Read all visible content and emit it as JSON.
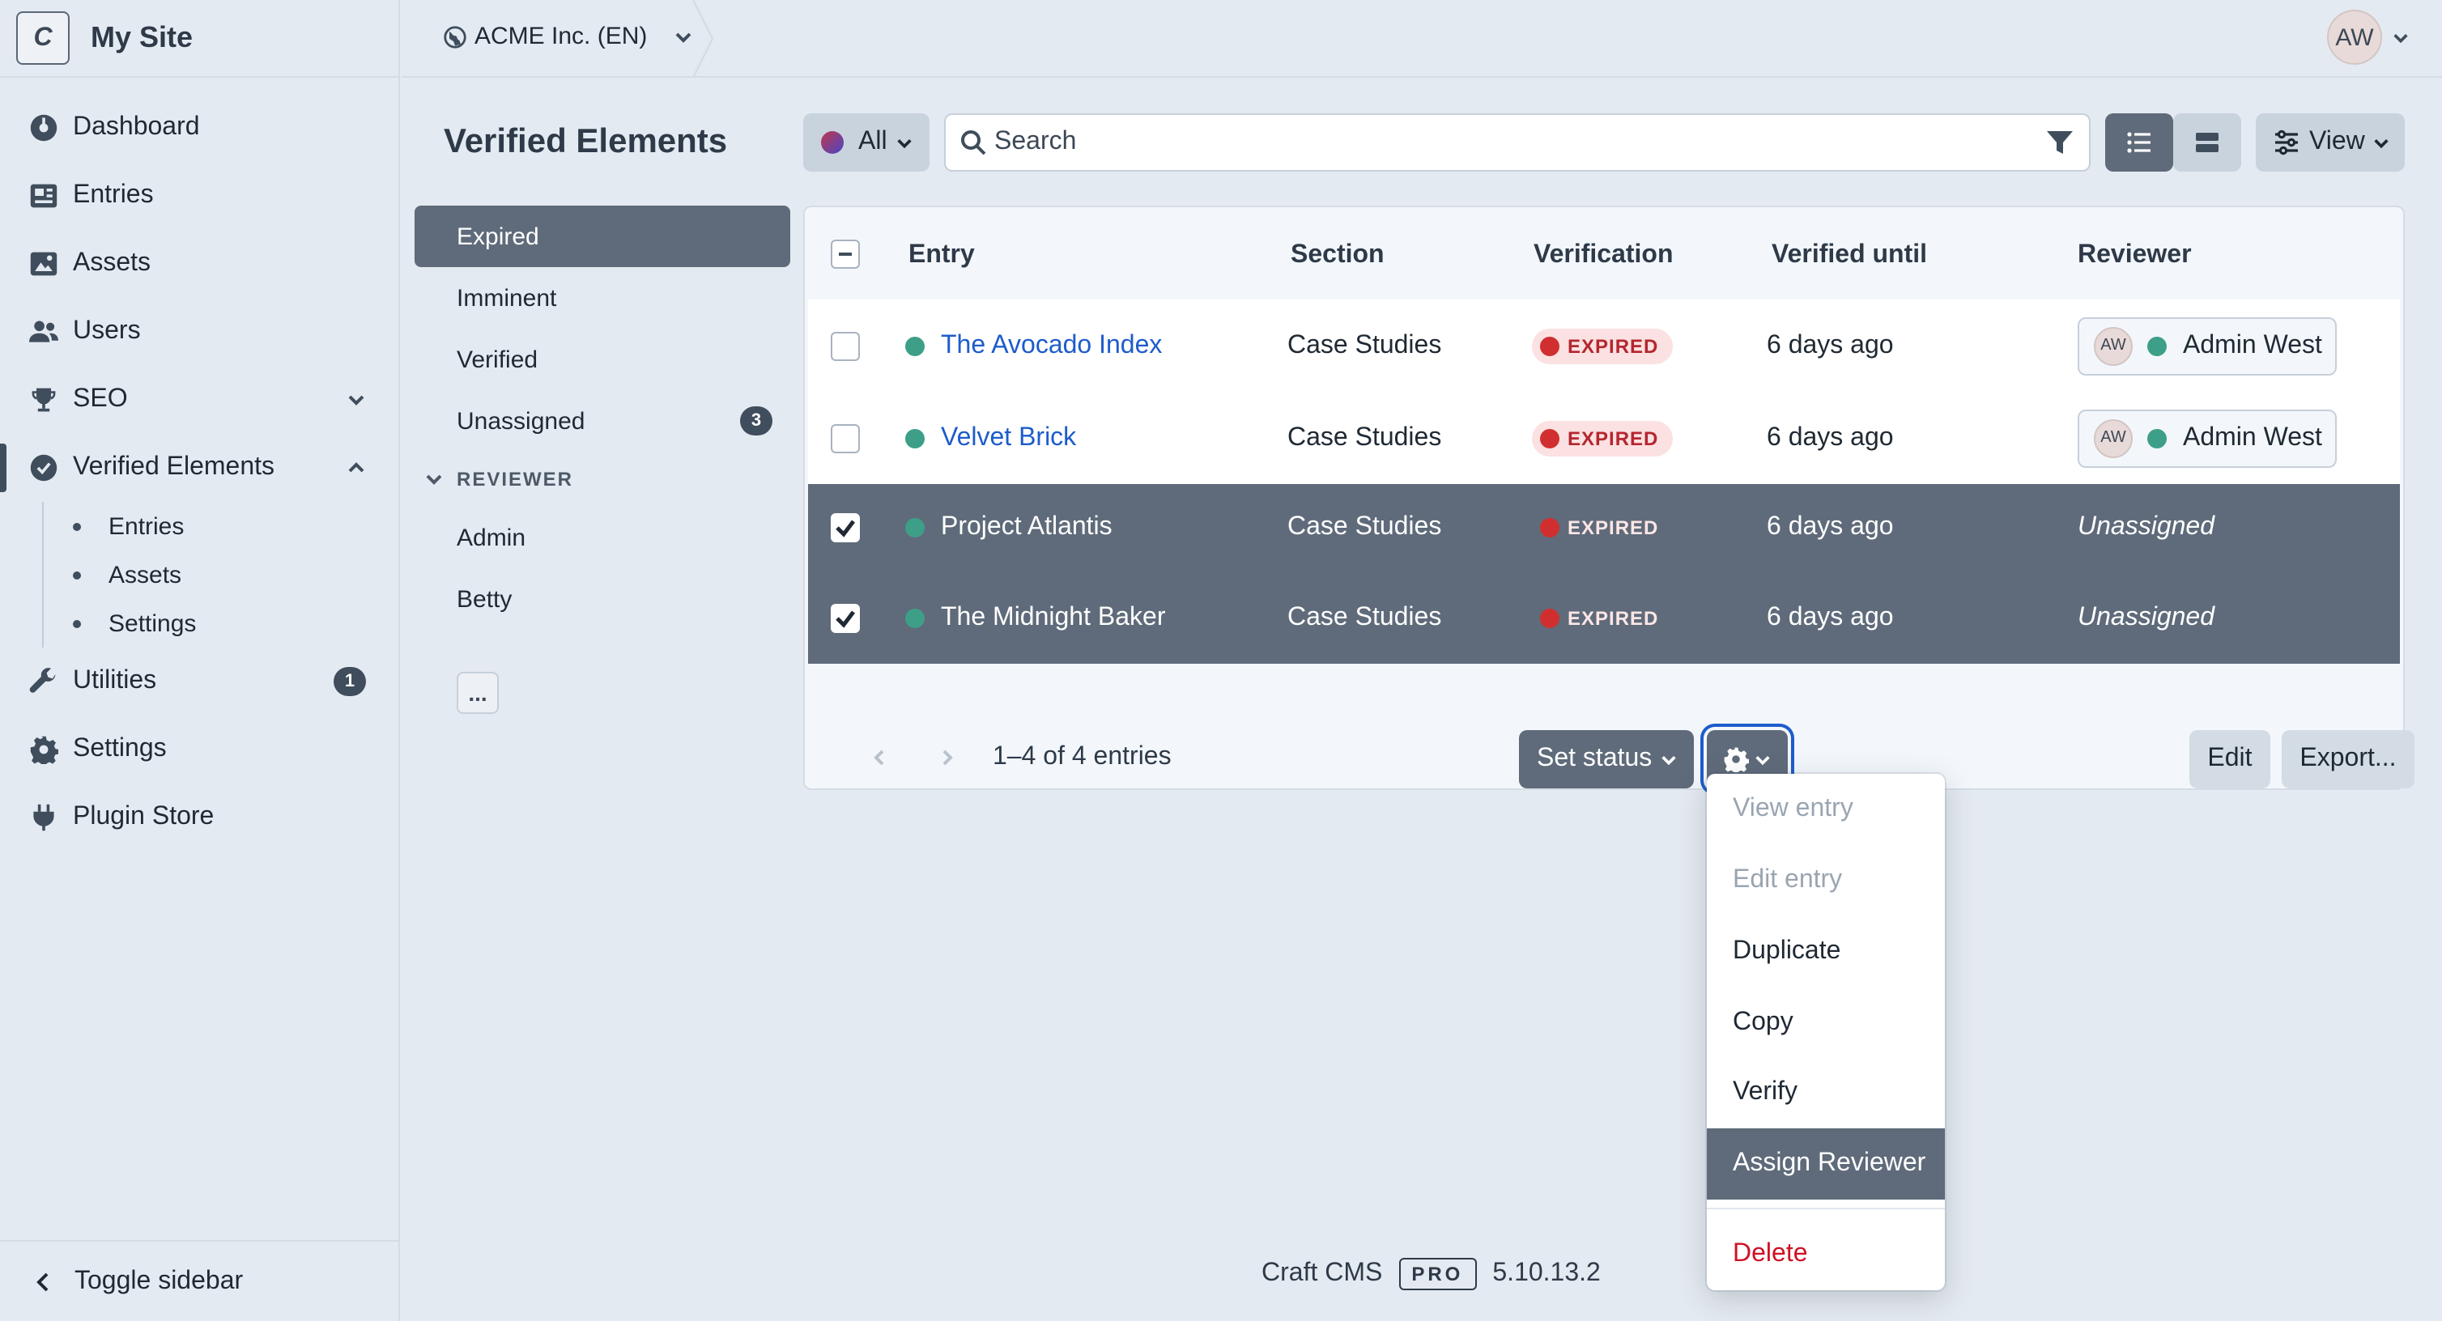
{
  "site": {
    "logo": "C",
    "name": "My Site"
  },
  "sidebar": {
    "items": [
      {
        "label": "Dashboard",
        "icon": "dashboard-icon"
      },
      {
        "label": "Entries",
        "icon": "entries-icon"
      },
      {
        "label": "Assets",
        "icon": "image-icon"
      },
      {
        "label": "Users",
        "icon": "users-icon"
      },
      {
        "label": "SEO",
        "icon": "trophy-icon"
      },
      {
        "label": "Verified Elements",
        "icon": "check-badge-icon"
      },
      {
        "label": "Utilities",
        "icon": "wrench-icon",
        "badge": "1"
      },
      {
        "label": "Settings",
        "icon": "gear-icon"
      },
      {
        "label": "Plugin Store",
        "icon": "plug-icon"
      }
    ],
    "subitems": [
      "Entries",
      "Assets",
      "Settings"
    ],
    "toggle_label": "Toggle sidebar"
  },
  "topbar": {
    "site_switcher": "ACME Inc. (EN)",
    "user_initials": "AW"
  },
  "page": {
    "title": "Verified Elements",
    "status_filter": "All",
    "search_placeholder": "Search",
    "view_label": "View"
  },
  "sources": {
    "items": [
      {
        "label": "Expired"
      },
      {
        "label": "Imminent"
      },
      {
        "label": "Verified"
      },
      {
        "label": "Unassigned",
        "count": "3"
      }
    ],
    "reviewer_heading": "REVIEWER",
    "reviewers": [
      "Admin",
      "Betty"
    ],
    "more_label": "..."
  },
  "table": {
    "columns": [
      "Entry",
      "Section",
      "Verification",
      "Verified until",
      "Reviewer"
    ],
    "rows": [
      {
        "entry": "The Avocado Index",
        "section": "Case Studies",
        "verification": "EXPIRED",
        "until": "6 days ago",
        "reviewer_initials": "AW",
        "reviewer": "Admin West",
        "selected": false
      },
      {
        "entry": "Velvet Brick",
        "section": "Case Studies",
        "verification": "EXPIRED",
        "until": "6 days ago",
        "reviewer_initials": "AW",
        "reviewer": "Admin West",
        "selected": false
      },
      {
        "entry": "Project Atlantis",
        "section": "Case Studies",
        "verification": "EXPIRED",
        "until": "6 days ago",
        "reviewer": "Unassigned",
        "selected": true
      },
      {
        "entry": "The Midnight Baker",
        "section": "Case Studies",
        "verification": "EXPIRED",
        "until": "6 days ago",
        "reviewer": "Unassigned",
        "selected": true
      }
    ],
    "pagination": "1–4 of 4 entries",
    "set_status_label": "Set status",
    "edit_label": "Edit",
    "export_label": "Export..."
  },
  "actions_menu": {
    "items": [
      {
        "label": "View entry",
        "state": "disabled"
      },
      {
        "label": "Edit entry",
        "state": "disabled"
      },
      {
        "label": "Duplicate",
        "state": "normal"
      },
      {
        "label": "Copy",
        "state": "normal"
      },
      {
        "label": "Verify",
        "state": "normal"
      },
      {
        "label": "Assign Reviewer",
        "state": "highlighted"
      },
      {
        "label": "Delete",
        "state": "danger"
      }
    ]
  },
  "footer": {
    "product": "Craft CMS",
    "edition": "PRO",
    "version": "5.10.13.2"
  },
  "colors": {
    "accent": "#5f6b7a",
    "link": "#1d5ccc",
    "status_enabled": "#3d9f88",
    "expired": "#d12f2f",
    "danger": "#cf1124",
    "background": "#e4eaf1"
  }
}
